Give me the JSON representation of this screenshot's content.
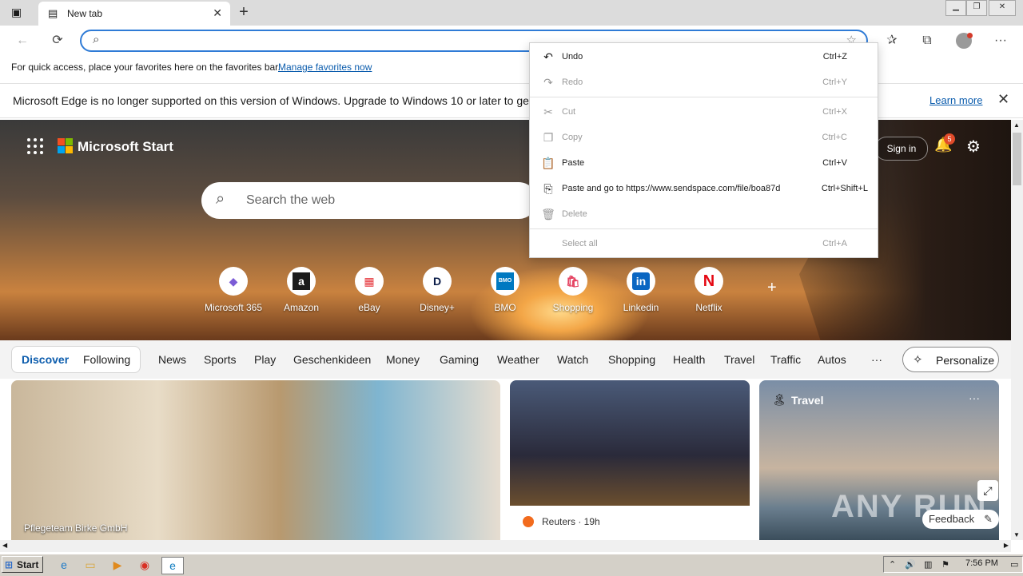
{
  "browser": {
    "tab_title": "New tab",
    "new_tab_symbol": "+",
    "address_value": "",
    "favbar_text": "For quick access, place your favorites here on the favorites bar.",
    "favbar_link": "Manage favorites now"
  },
  "infobar": {
    "message": "Microsoft Edge is no longer supported on this version of Windows. Upgrade to Windows 10 or later to get re",
    "learn_more": "Learn more"
  },
  "start": {
    "brand": "Microsoft Start",
    "search_placeholder": "Search the web",
    "sign_in": "Sign in",
    "notification_count": "5",
    "tiles": [
      {
        "name": "Microsoft 365",
        "glyph": "◆",
        "color": "#7b5cd6"
      },
      {
        "name": "Amazon",
        "glyph": "a",
        "color": "#1b1b1b"
      },
      {
        "name": "eBay",
        "glyph": "▦",
        "color": "#e53238"
      },
      {
        "name": "Disney+",
        "glyph": "D",
        "color": "#0b1d49"
      },
      {
        "name": "BMO",
        "glyph": "BMO",
        "color": "#0079c1"
      },
      {
        "name": "Shopping",
        "glyph": "🛍",
        "color": "#e4405f"
      },
      {
        "name": "Linkedin",
        "glyph": "in",
        "color": "#0a66c2"
      },
      {
        "name": "Netflix",
        "glyph": "N",
        "color": "#e50914"
      }
    ],
    "add_tile": "+"
  },
  "feed_nav": {
    "discover": "Discover",
    "following": "Following",
    "items": [
      "News",
      "Sports",
      "Play",
      "Geschenkideen",
      "Money",
      "Gaming",
      "Weather",
      "Watch",
      "Shopping",
      "Health",
      "Travel",
      "Traffic",
      "Autos"
    ],
    "more": "···",
    "personalize": "Personalize"
  },
  "cards": {
    "card1_caption": "Pflegeteam Birke GmbH",
    "card2_source": "Reuters · 19h",
    "card3_title": "Travel",
    "card3_menu": "···",
    "feedback": "Feedback"
  },
  "context_menu": [
    {
      "label": "Undo",
      "shortcut": "Ctrl+Z",
      "enabled": true,
      "icon": "undo-icon",
      "glyph": "↶"
    },
    {
      "label": "Redo",
      "shortcut": "Ctrl+Y",
      "enabled": false,
      "icon": "redo-icon",
      "glyph": "↷"
    },
    {
      "label": "Cut",
      "shortcut": "Ctrl+X",
      "enabled": false,
      "icon": "cut-icon",
      "glyph": "✂"
    },
    {
      "label": "Copy",
      "shortcut": "Ctrl+C",
      "enabled": false,
      "icon": "copy-icon",
      "glyph": "❐"
    },
    {
      "label": "Paste",
      "shortcut": "Ctrl+V",
      "enabled": true,
      "icon": "paste-icon",
      "glyph": "📋"
    },
    {
      "label": "Paste and go to https://www.sendspace.com/file/boa87d",
      "shortcut": "Ctrl+Shift+L",
      "enabled": true,
      "icon": "paste-go-icon",
      "glyph": "⎘"
    },
    {
      "label": "Delete",
      "shortcut": "",
      "enabled": false,
      "icon": "delete-icon",
      "glyph": "🗑"
    },
    {
      "label": "Select all",
      "shortcut": "Ctrl+A",
      "enabled": false,
      "icon": "",
      "glyph": ""
    }
  ],
  "taskbar": {
    "start": "Start",
    "clock": "7:56 PM"
  },
  "watermark": "ANY RUN"
}
